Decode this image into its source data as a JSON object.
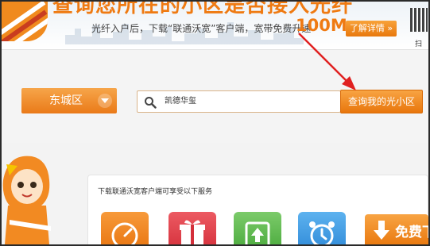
{
  "banner": {
    "headline": "查询您所在的小区是否接入光纤",
    "subline": "光纤入户后，下载“联通沃宽”客户端，宽带免费升速",
    "speed": "100M.",
    "detail_button": "了解详情 »",
    "qr_caption": "扫一"
  },
  "search": {
    "district": "东城区",
    "query_value": "凯德华玺",
    "submit_label": "查询我的光小区"
  },
  "services": {
    "title": "下载联通沃宽客户端可享受以下服务",
    "tiles": [
      {
        "icon": "speedometer-icon",
        "color": "#f07d1a"
      },
      {
        "icon": "gift-icon",
        "color": "#e2404a"
      },
      {
        "icon": "upload-icon",
        "color": "#59b94d"
      },
      {
        "icon": "alarm-clock-icon",
        "color": "#3a9ae0"
      }
    ],
    "download_label": "免费下"
  },
  "annotation": {
    "arrow_color": "#e02020"
  },
  "colors": {
    "accent": "#ef7a12"
  }
}
